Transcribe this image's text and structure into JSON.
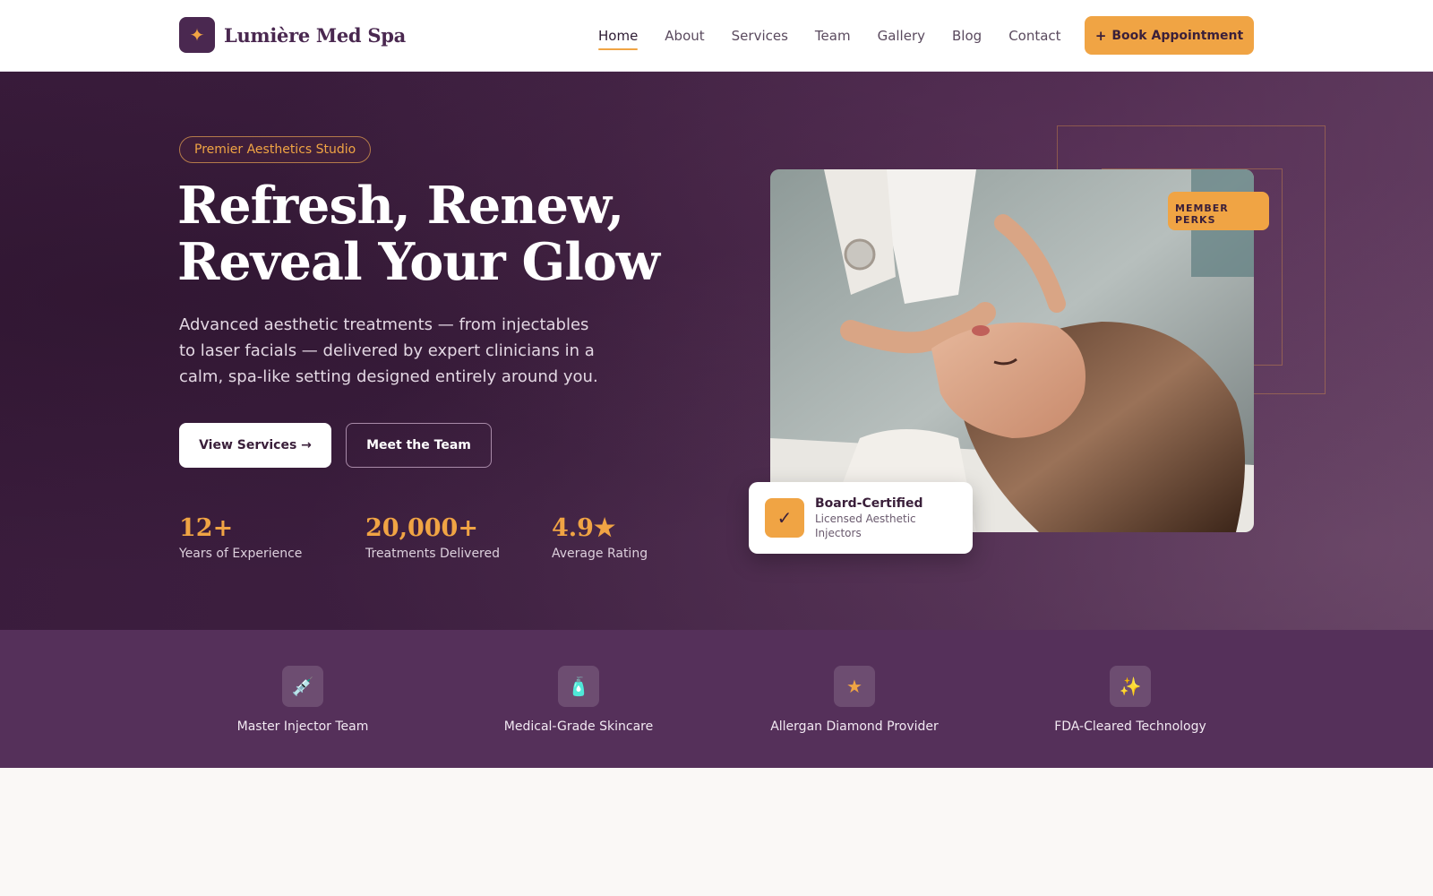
{
  "brand": {
    "name": "Lumière Med Spa",
    "logo_icon": "sparkle-icon",
    "logo_glyph": "✦",
    "accent_color": "#f0a444",
    "primary_color": "#4a2850"
  },
  "nav": {
    "items": [
      {
        "label": "Home",
        "active": true
      },
      {
        "label": "About"
      },
      {
        "label": "Services"
      },
      {
        "label": "Team"
      },
      {
        "label": "Gallery"
      },
      {
        "label": "Blog"
      },
      {
        "label": "Contact"
      }
    ],
    "cta_icon": "+",
    "cta_label": "Book Appointment"
  },
  "hero": {
    "badge": "Premier Aesthetics Studio",
    "title_line1": "Refresh, Renew,",
    "title_line2": "Reveal Your Glow",
    "subtitle": "Advanced aesthetic treatments — from injectables to laser facials — delivered by expert clinicians in a calm, spa-like setting designed entirely around you.",
    "primary_button": "View Services →",
    "secondary_button": "Meet the Team",
    "stats": [
      {
        "value": "12+",
        "label": "Years of Experience"
      },
      {
        "value": "20,000+",
        "label": "Treatments Delivered"
      },
      {
        "value": "4.9★",
        "label": "Average Rating"
      }
    ],
    "perks_badge": "MEMBER PERKS",
    "cert_card": {
      "icon": "checkmark-icon",
      "glyph": "✓",
      "title": "Board-Certified",
      "description": "Licensed Aesthetic Injectors"
    }
  },
  "features": [
    {
      "icon": "syringe-icon",
      "glyph": "💉",
      "label": "Master Injector Team"
    },
    {
      "icon": "bottle-icon",
      "glyph": "🧴",
      "label": "Medical-Grade Skincare"
    },
    {
      "icon": "star-icon",
      "glyph": "★",
      "label": "Allergan Diamond Provider"
    },
    {
      "icon": "sparkles-icon",
      "glyph": "✨",
      "label": "FDA-Cleared Technology"
    }
  ]
}
